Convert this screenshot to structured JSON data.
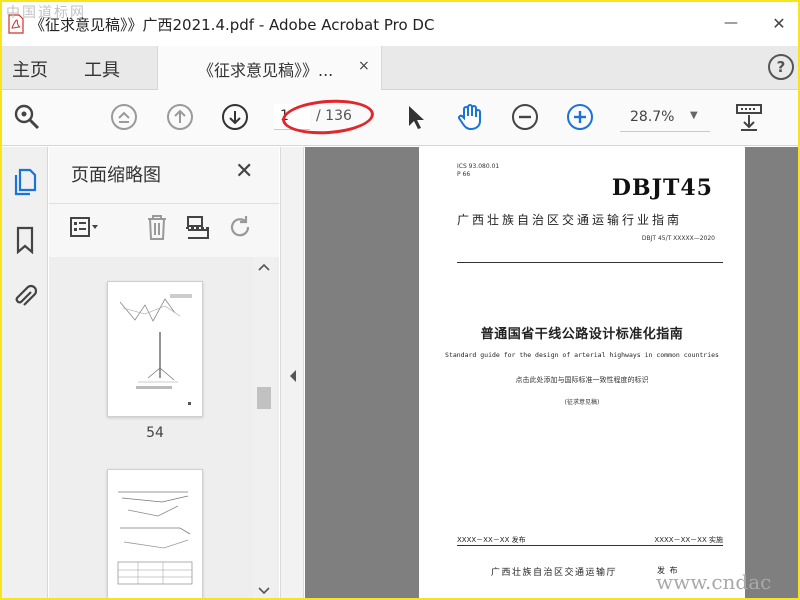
{
  "watermark": {
    "top": "中国道标网",
    "bottom": "www.cndac"
  },
  "window": {
    "title": "《征求意见稿》》广西2021.4.pdf - Adobe Acrobat Pro DC",
    "minimize": "—",
    "close": "✕"
  },
  "nav": {
    "home": "主页",
    "tools": "工具"
  },
  "tab": {
    "label": "《征求意见稿》》...",
    "close": "×"
  },
  "help": "?",
  "toolbar": {
    "page_current": "1",
    "page_total": "/ 136",
    "zoom": "28.7%",
    "zoom_caret": "▼"
  },
  "thumbnail_panel": {
    "title": "页面缩略图",
    "close": "✕",
    "pages": [
      {
        "label": "54"
      },
      {
        "label": ""
      }
    ]
  },
  "document": {
    "ics": "ICS  93.080.01",
    "p": "P 66",
    "dbjt": "DBJT45",
    "guide": "广西壮族自治区交通运输行业指南",
    "code": "DBJT 45/T XXXXX—2020",
    "main_title": "普通国省干线公路设计标准化指南",
    "english_title": "Standard guide for the design of arterial highways in common countries",
    "note": "点击此处添加与国际标准一致性程度的标识",
    "draft": "(征求意见稿)",
    "publish_date": "XXXX－XX－XX 发布",
    "implement_date": "XXXX－XX－XX 实施",
    "issuer": "广西壮族自治区交通运输厅",
    "issued": "发 布"
  },
  "colors": {
    "frame": "#f5e51a",
    "accent": "#1a73d9",
    "ellipse": "#e2262b",
    "doc_bg": "#7f7f7f"
  }
}
